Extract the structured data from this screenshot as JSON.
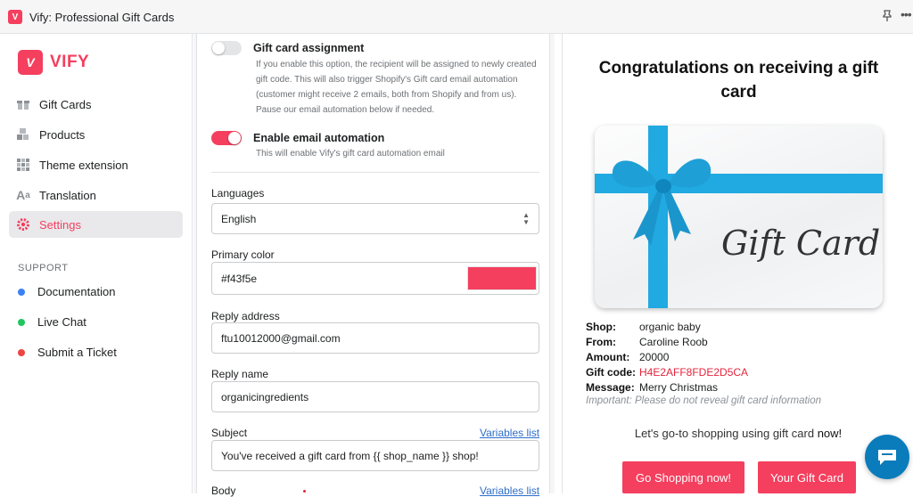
{
  "window": {
    "title": "Vify: Professional Gift Cards",
    "pin_icon": "pin-icon",
    "more_icon": "more-icon"
  },
  "brand": {
    "name": "VIFY",
    "logo_mark": "V"
  },
  "sidebar": {
    "items": [
      {
        "label": "Gift Cards",
        "icon": "gift-icon"
      },
      {
        "label": "Products",
        "icon": "products-icon"
      },
      {
        "label": "Theme extension",
        "icon": "grid-icon"
      },
      {
        "label": "Translation",
        "icon": "translation-icon"
      },
      {
        "label": "Settings",
        "icon": "gear-icon",
        "active": true
      }
    ],
    "support_title": "SUPPORT",
    "support_items": [
      {
        "label": "Documentation",
        "color": "#3b82f6"
      },
      {
        "label": "Live Chat",
        "color": "#22c55e"
      },
      {
        "label": "Submit a Ticket",
        "color": "#ef4444"
      }
    ]
  },
  "settings": {
    "assignment": {
      "title": "Gift card assignment",
      "enabled": false,
      "desc_lines": [
        "If you enable this option, the recipient will be assigned to newly created",
        "gift code. This will also trigger Shopify's Gift card email automation",
        "(customer might receive 2 emails, both from Shopify and from us).",
        "Pause our email automation below if needed."
      ]
    },
    "automation": {
      "title": "Enable email automation",
      "enabled": true,
      "desc": "This will enable Vify's gift card automation email"
    },
    "languages": {
      "label": "Languages",
      "value": "English"
    },
    "primary_color": {
      "label": "Primary color",
      "value": "#f43f5e"
    },
    "reply_address": {
      "label": "Reply address",
      "value": "ftu10012000@gmail.com"
    },
    "reply_name": {
      "label": "Reply name",
      "value": "organicingredients"
    },
    "subject": {
      "label": "Subject",
      "link": "Variables list",
      "value": "You've received a gift card from {{ shop_name }} shop!"
    },
    "body": {
      "label": "Body",
      "link": "Variables list"
    }
  },
  "preview": {
    "title": "Congratulations on receiving a gift card",
    "card_text": "Gift Card",
    "shop": {
      "k": "Shop:",
      "v": "organic baby"
    },
    "from": {
      "k": "From:",
      "v": "Caroline Roob"
    },
    "amount": {
      "k": "Amount:",
      "v": "20000"
    },
    "code": {
      "k": "Gift code:",
      "v": "H4E2AFF8FDE2D5CA"
    },
    "message": {
      "k": "Message:",
      "v": "Merry Christmas"
    },
    "note": "Important: Please do not reveal gift card information",
    "shop_line_prefix": "Let's go-to shopping using gift card ",
    "shop_line_emph": "now!",
    "btn_shop": "Go Shopping now!",
    "btn_card": "Your Gift Card"
  },
  "colors": {
    "accent": "#f43f5e",
    "ribbon": "#21a9e1",
    "link": "#2c6ecb",
    "chat": "#0a7cbc"
  }
}
